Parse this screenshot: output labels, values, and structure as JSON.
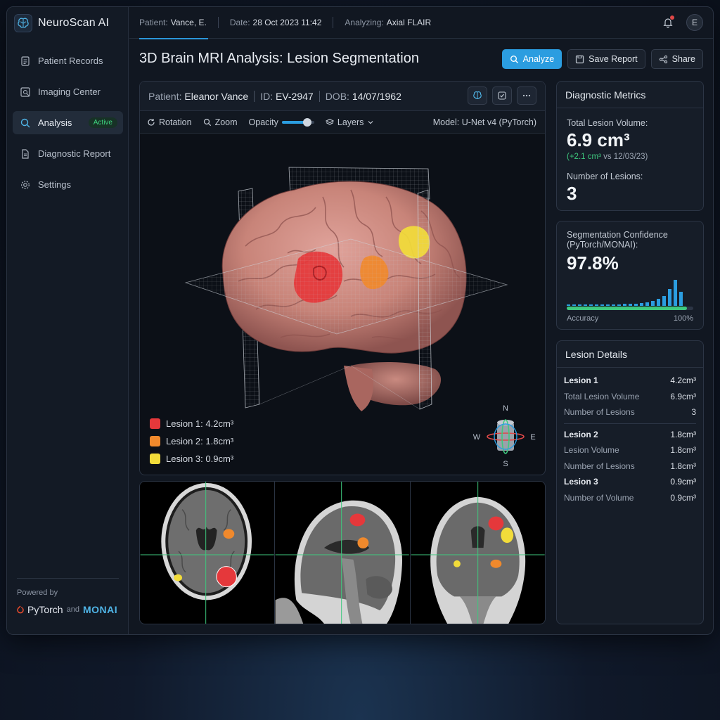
{
  "app": {
    "name": "NeuroScan AI"
  },
  "sidebar": {
    "items": [
      {
        "label": "Patient Records"
      },
      {
        "label": "Imaging Center"
      },
      {
        "label": "Analysis",
        "badge": "Active"
      },
      {
        "label": "Diagnostic Report"
      },
      {
        "label": "Settings"
      }
    ],
    "powered_by": "Powered by",
    "pytorch": "PyTorch",
    "and": "and",
    "monai": "MONAI"
  },
  "topbar": {
    "patient_label": "Patient:",
    "patient_value": "Vance, E.",
    "date_label": "Date:",
    "date_value": "28 Oct 2023 11:42",
    "analyzing_label": "Analyzing:",
    "analyzing_value": "Axial FLAIR",
    "avatar_initial": "E"
  },
  "page": {
    "title": "3D Brain MRI Analysis: Lesion Segmentation"
  },
  "actions": {
    "analyze": "Analyze",
    "save_report": "Save Report",
    "share": "Share"
  },
  "viewer": {
    "patient_label": "Patient:",
    "patient_value": "Eleanor Vance",
    "id_label": "ID:",
    "id_value": "EV-2947",
    "dob_label": "DOB:",
    "dob_value": "14/07/1962",
    "toolbar": {
      "rotation": "Rotation",
      "zoom": "Zoom",
      "opacity": "Opacity",
      "opacity_level": 0.78,
      "layers": "Layers",
      "model": "Model: U-Net v4 (PyTorch)"
    },
    "legend": [
      {
        "label": "Lesion 1: 4.2cm³",
        "color": "#e5383b"
      },
      {
        "label": "Lesion 2: 1.8cm³",
        "color": "#f0892c"
      },
      {
        "label": "Lesion 3: 0.9cm³",
        "color": "#f2dc3a"
      }
    ],
    "compass": {
      "n": "N",
      "s": "S",
      "e": "E",
      "w": "W"
    }
  },
  "metrics": {
    "title": "Diagnostic Metrics",
    "total_volume_label": "Total Lesion Volume:",
    "total_volume_value": "6.9 cm³",
    "delta": "(+2.1 cm³",
    "delta_ref": "vs 12/03/23)",
    "num_lesions_label": "Number of Lesions:",
    "num_lesions_value": "3"
  },
  "confidence": {
    "label_line1": "Segmentation Confidence",
    "label_line2": "(PyTorch/MONAI):",
    "value": "97.8%",
    "accuracy_label": "Accuracy",
    "accuracy_max": "100%",
    "accuracy_fraction": 0.95
  },
  "lesion_details": {
    "title": "Lesion Details",
    "groups": [
      {
        "rows": [
          {
            "label": "Lesion 1",
            "value": "4.2cm³"
          },
          {
            "label": "Total Lesion Volume",
            "value": "6.9cm³"
          },
          {
            "label": "Number of Lesions",
            "value": "3"
          }
        ]
      },
      {
        "rows": [
          {
            "label": "Lesion 2",
            "value": "1.8cm³"
          },
          {
            "label": "Lesion Volume",
            "value": "1.8cm³"
          },
          {
            "label": "Number of Lesions",
            "value": "1.8cm³"
          },
          {
            "label": "Lesion 3",
            "value": "0.9cm³"
          },
          {
            "label": "Number of Volume",
            "value": "0.9cm³"
          }
        ]
      }
    ]
  },
  "colors": {
    "accent": "#2b9de0",
    "success": "#3ec97e",
    "lesion1": "#e5383b",
    "lesion2": "#f0892c",
    "lesion3": "#f2dc3a"
  }
}
